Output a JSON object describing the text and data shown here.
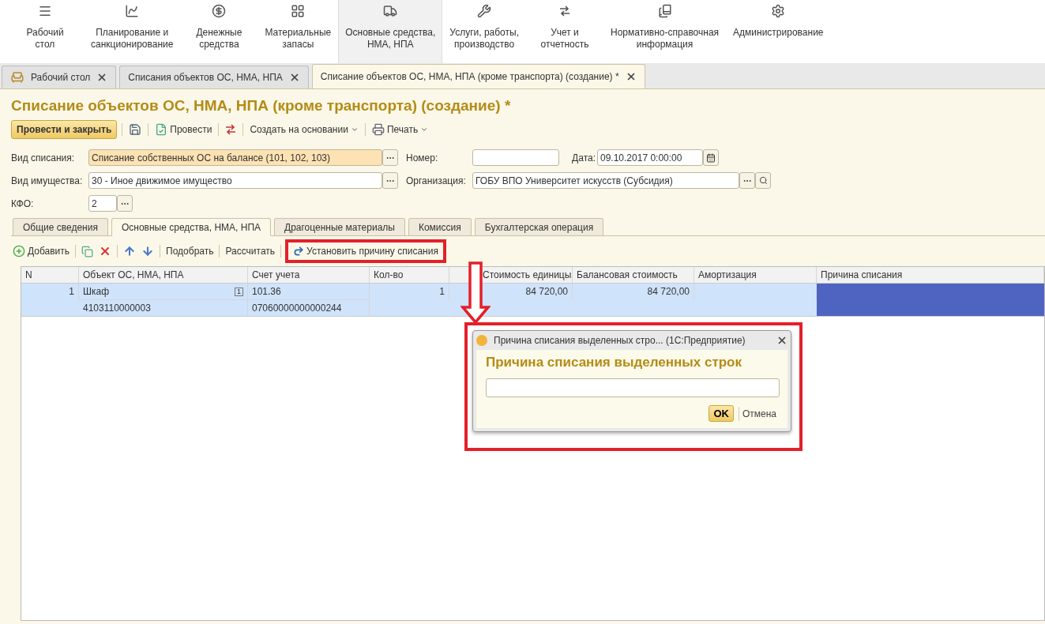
{
  "sections": [
    {
      "lines": [
        "Рабочий",
        "стол"
      ],
      "selected": false
    },
    {
      "lines": [
        "Планирование и",
        "санкционирование"
      ],
      "selected": false
    },
    {
      "lines": [
        "Денежные",
        "средства"
      ],
      "selected": false
    },
    {
      "lines": [
        "Материальные",
        "запасы"
      ],
      "selected": false
    },
    {
      "lines": [
        "Основные средства,",
        "НМА, НПА"
      ],
      "selected": true
    },
    {
      "lines": [
        "Услуги, работы,",
        "производство"
      ],
      "selected": false
    },
    {
      "lines": [
        "Учет и",
        "отчетность"
      ],
      "selected": false
    },
    {
      "lines": [
        "Нормативно-справочная",
        "информация"
      ],
      "selected": false
    },
    {
      "lines": [
        "Администрирование"
      ],
      "selected": false
    }
  ],
  "open_tabs": [
    {
      "label": "Рабочий стол",
      "selected": false
    },
    {
      "label": "Списания объектов ОС, НМА, НПА",
      "selected": false
    },
    {
      "label": "Списание объектов ОС, НМА, НПА (кроме транспорта) (создание) *",
      "selected": true
    }
  ],
  "document": {
    "title": "Списание объектов ОС, НМА, НПА (кроме транспорта) (создание) *",
    "toolbar": [
      {
        "kind": "primary",
        "label": "Провести и закрыть"
      },
      {
        "kind": "save"
      },
      {
        "kind": "post",
        "label": "Провести"
      },
      {
        "kind": "dtkt"
      },
      {
        "kind": "menu",
        "label": "Создать на основании"
      },
      {
        "kind": "print",
        "label": "Печать"
      }
    ],
    "write_off_type": {
      "label": "Вид списания:",
      "value": "Списание собственных ОС на балансе (101, 102, 103)",
      "focused": true
    },
    "number": {
      "label": "Номер:"
    },
    "date": {
      "label": "Дата:",
      "value": "09.10.2017  0:00:00"
    },
    "property_type": {
      "label": "Вид имущества:",
      "value": "30 - Иное движимое имущество",
      "focused": false
    },
    "organization": {
      "label": "Организация:",
      "value": "ГОБУ ВПО Университет искусств (Субсидия)"
    },
    "kfo": {
      "label": "КФО:",
      "value": "2"
    },
    "tabs": [
      {
        "label": "Общие сведения",
        "selected": false
      },
      {
        "label": "Основные средства, НМА, НПА",
        "selected": true
      },
      {
        "label": "Драгоценные материалы",
        "selected": false
      },
      {
        "label": "Комиссия",
        "selected": false
      },
      {
        "label": "Бухгалтерская операция",
        "selected": false
      }
    ],
    "table_toolbar": [
      {
        "kind": "add",
        "label": "Добавить"
      },
      {
        "kind": "copy"
      },
      {
        "kind": "delete"
      },
      {
        "kind": "up"
      },
      {
        "kind": "down"
      },
      {
        "kind": "text",
        "label": "Подобрать"
      },
      {
        "kind": "text",
        "label": "Рассчитать"
      },
      {
        "kind": "reason",
        "label": "Установить причину списания",
        "highlighted": true
      }
    ],
    "columns": [
      "N",
      "Объект ОС, НМА, НПА",
      "Счет учета",
      "Кол-во",
      "Стоимость единицы",
      "Балансовая стоимость",
      "Амортизация",
      "Причина списания"
    ],
    "rows": [
      {
        "selected": true,
        "n": "1",
        "object": "Шкаф",
        "object_code": "4103110000003",
        "marker": "1",
        "account": "101.36",
        "account_code": "07060000000000244",
        "quantity": "1",
        "unit_cost": "84 720,00",
        "book_value": "84 720,00"
      }
    ]
  },
  "dialog": {
    "window_title": "Причина списания выделенных стро...  (1С:Предприятие)",
    "heading": "Причина списания выделенных строк",
    "ok": "OK",
    "cancel": "Отмена",
    "highlighted": true
  }
}
